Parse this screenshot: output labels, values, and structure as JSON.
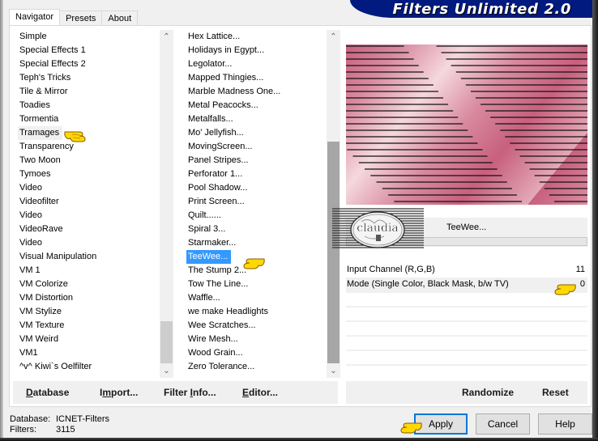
{
  "window": {
    "banner_title": "Filters Unlimited 2.0"
  },
  "tabs": [
    {
      "label": "Navigator",
      "active": true
    },
    {
      "label": "Presets",
      "active": false
    },
    {
      "label": "About",
      "active": false
    }
  ],
  "categories": {
    "items": [
      "Simple",
      "Special Effects 1",
      "Special Effects 2",
      "Teph's Tricks",
      "Tile & Mirror",
      "Toadies",
      "Tormentia",
      "Tramages",
      "Transparency",
      "Two Moon",
      "Tymoes",
      "Video",
      "Videofilter",
      "Video",
      "VideoRave",
      "Video",
      "Visual Manipulation",
      "VM 1",
      "VM Colorize",
      "VM Distortion",
      "VM Stylize",
      "VM Texture",
      "VM Weird",
      "VM1",
      "^v^ Kiwi`s Oelfilter"
    ],
    "selected": "Tramages",
    "scroll_position_percent": 95
  },
  "filters": {
    "items": [
      "Hex Lattice...",
      "Holidays in Egypt...",
      "Legolator...",
      "Mapped Thingies...",
      "Marble Madness One...",
      "Metal Peacocks...",
      "Metalfalls...",
      "Mo' Jellyfish...",
      "MovingScreen...",
      "Panel Stripes...",
      "Perforator 1...",
      "Pool Shadow...",
      "Print Screen...",
      "Quilt......",
      "Spiral 3...",
      "Starmaker...",
      "TeeWee...",
      "The Stump 2...",
      "Tow The Line...",
      "Waffle...",
      "we make Headlights",
      "Wee Scratches...",
      "Wire Mesh...",
      "Wood Grain...",
      "Zero Tolerance..."
    ],
    "selected": "TeeWee...",
    "scroll_position_percent": 60
  },
  "preview": {
    "description": "pink diagonal gradient with horizontal black TV lines",
    "colors": {
      "dark_pink": "#c7607e",
      "light_pink": "#f5d8de"
    }
  },
  "filter_panel": {
    "filter_name": "TeeWee...",
    "watermark": "claudia"
  },
  "parameters": [
    {
      "label": "Input Channel (R,G,B)",
      "value": "11"
    },
    {
      "label": "Mode (Single Color, Black Mask, b/w TV)",
      "value": "0"
    }
  ],
  "left_buttons": {
    "database": {
      "pre": "",
      "ul": "D",
      "post": "atabase"
    },
    "import": {
      "pre": "I",
      "ul": "m",
      "post": "port..."
    },
    "filter_info": {
      "pre": "Filter ",
      "ul": "I",
      "post": "nfo..."
    },
    "editor": {
      "pre": "",
      "ul": "E",
      "post": "ditor..."
    }
  },
  "right_buttons": {
    "randomize": "Randomize",
    "reset": "Reset"
  },
  "status": {
    "database_label": "Database:",
    "database_value": "ICNET-Filters",
    "filters_label": "Filters:",
    "filters_value": "3115"
  },
  "dialog_buttons": {
    "apply": "Apply",
    "cancel": "Cancel",
    "help": "Help"
  },
  "colors": {
    "banner_blue": "#001a80",
    "selection_blue": "#3399ff",
    "default_button_border": "#0078d7",
    "pointer_yellow": "#ffd800"
  }
}
